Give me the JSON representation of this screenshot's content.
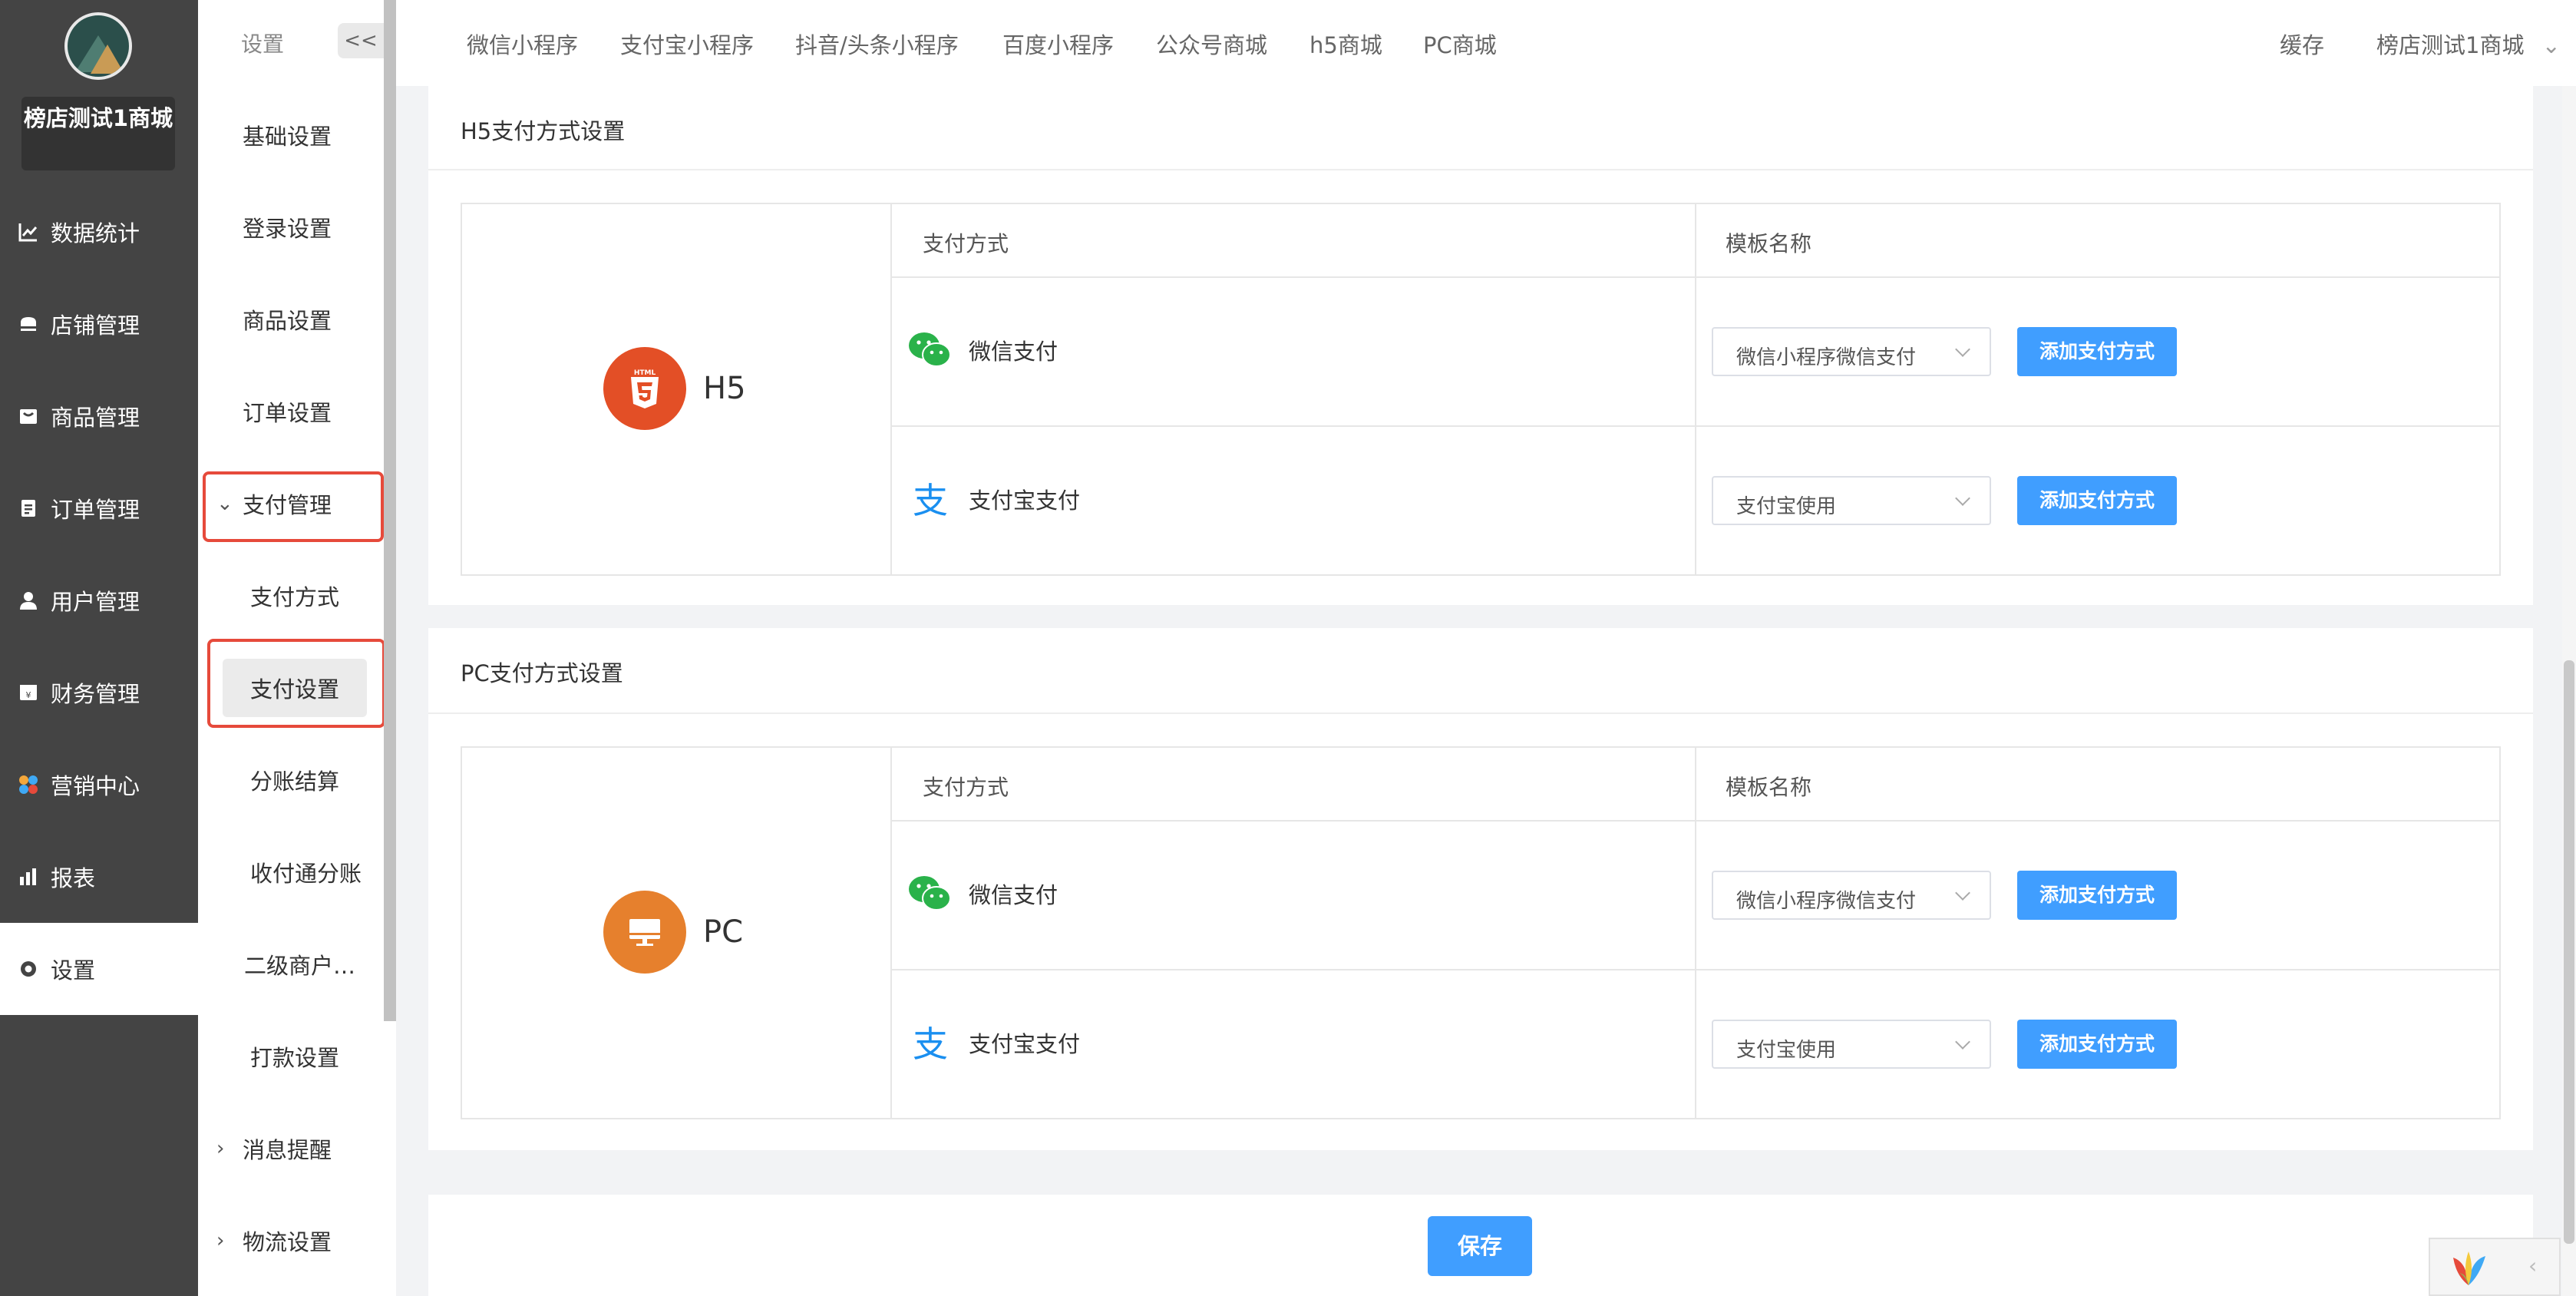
{
  "sidebar": {
    "shop_name": "榜店测试1商城",
    "items": [
      {
        "label": "数据统计",
        "icon": "chart-line-icon"
      },
      {
        "label": "店铺管理",
        "icon": "store-icon"
      },
      {
        "label": "商品管理",
        "icon": "goods-icon"
      },
      {
        "label": "订单管理",
        "icon": "order-icon"
      },
      {
        "label": "用户管理",
        "icon": "user-icon"
      },
      {
        "label": "财务管理",
        "icon": "finance-icon"
      },
      {
        "label": "营销中心",
        "icon": "marketing-icon"
      },
      {
        "label": "报表",
        "icon": "report-icon"
      },
      {
        "label": "设置",
        "icon": "settings-icon",
        "active": true
      }
    ]
  },
  "subnav": {
    "title": "设置",
    "collapse": "<<",
    "items": [
      {
        "label": "基础设置"
      },
      {
        "label": "登录设置"
      },
      {
        "label": "商品设置"
      },
      {
        "label": "订单设置"
      },
      {
        "label": "支付管理",
        "expanded": true
      },
      {
        "label": "支付方式"
      },
      {
        "label": "支付设置",
        "active": true
      },
      {
        "label": "分账结算"
      },
      {
        "label": "收付通分账"
      },
      {
        "label": "二级商户…"
      },
      {
        "label": "打款设置"
      },
      {
        "label": "消息提醒"
      },
      {
        "label": "物流设置"
      }
    ]
  },
  "topbar": {
    "tabs": [
      "微信小程序",
      "支付宝小程序",
      "抖音/头条小程序",
      "百度小程序",
      "公众号商城",
      "h5商城",
      "PC商城"
    ],
    "cache": "缓存",
    "shop": "榜店测试1商城"
  },
  "h5_section": {
    "title": "H5支付方式设置",
    "platform": "H5",
    "col_method": "支付方式",
    "col_template": "模板名称",
    "rows": [
      {
        "method": "微信支付",
        "template": "微信小程序微信支付",
        "button": "添加支付方式"
      },
      {
        "method": "支付宝支付",
        "template": "支付宝使用",
        "button": "添加支付方式"
      }
    ]
  },
  "pc_section": {
    "title": "PC支付方式设置",
    "platform": "PC",
    "col_method": "支付方式",
    "col_template": "模板名称",
    "rows": [
      {
        "method": "微信支付",
        "template": "微信小程序微信支付",
        "button": "添加支付方式"
      },
      {
        "method": "支付宝支付",
        "template": "支付宝使用",
        "button": "添加支付方式"
      }
    ]
  },
  "save_label": "保存",
  "colors": {
    "primary": "#409eff",
    "highlight": "#e64a3b",
    "h5_badge": "#e34f26",
    "pc_badge": "#e6802d",
    "wechat": "#2ab24a",
    "alipay": "#1a8ff0",
    "sidebar_bg": "#444444"
  }
}
